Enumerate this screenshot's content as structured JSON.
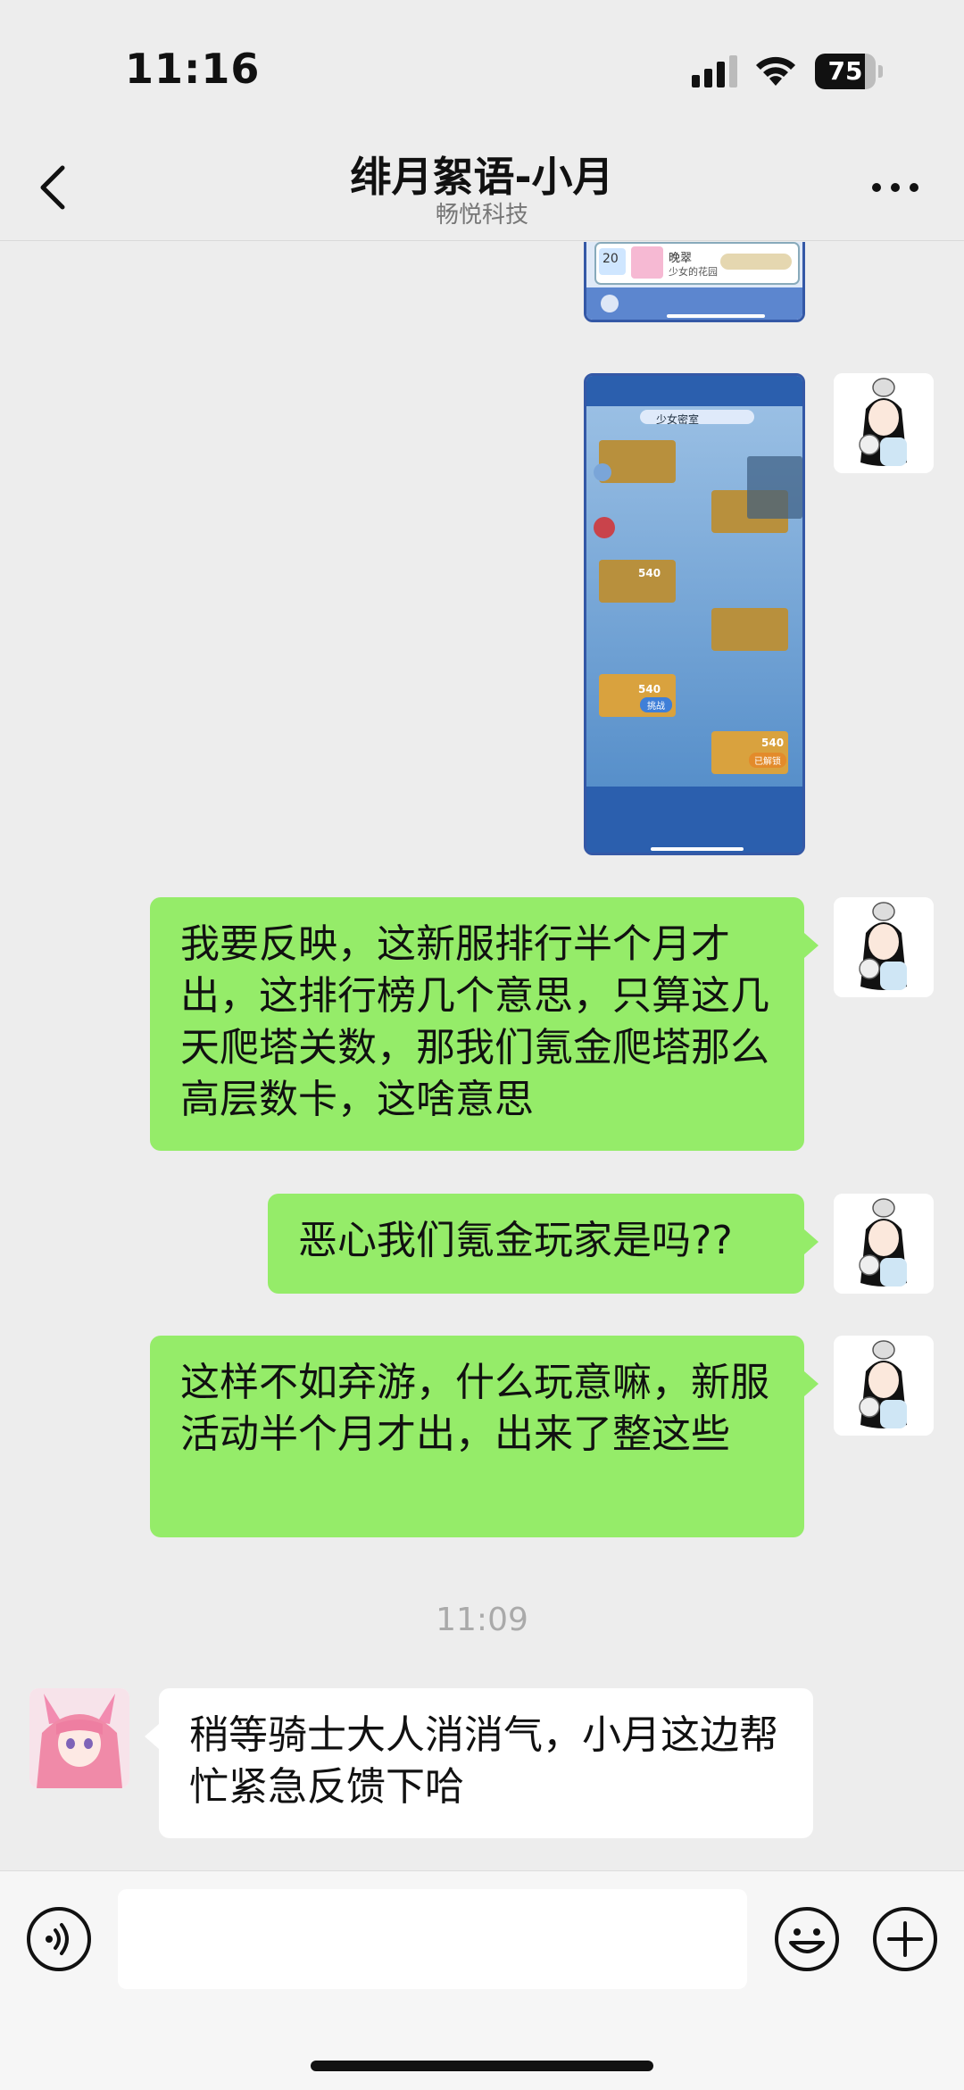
{
  "status_bar": {
    "time": "11:16",
    "battery": "75"
  },
  "header": {
    "title": "绯月絮语-小月",
    "subtitle": "畅悦科技"
  },
  "messages": [
    {
      "from": "me",
      "type": "image",
      "description_icon": "game-screenshot-partial"
    },
    {
      "from": "me",
      "type": "image",
      "image_title": "少女密室",
      "icon": "game-screenshot"
    },
    {
      "from": "me",
      "type": "text",
      "text": "我要反映，这新服排行半个月才出，这排行榜几个意思，只算这几天爬塔关数，那我们氪金爬塔那么高层数卡，这啥意思"
    },
    {
      "from": "me",
      "type": "text",
      "text": "恶心我们氪金玩家是吗??"
    },
    {
      "from": "me",
      "type": "text",
      "text": "这样不如弃游，什么玩意嘛，新服活动半个月才出，出来了整这些"
    },
    {
      "from": "other",
      "type": "text",
      "text": "稍等骑士大人消消气，小月这边帮忙紧急反馈下哈"
    }
  ],
  "timestamp": "11:09",
  "game_labels": {
    "challenge": "挑战",
    "unlocked": "已解锁",
    "score_a": "540",
    "score_b": "540",
    "score_c": "540",
    "level": "20",
    "name1": "晚翠",
    "name2": "少女的花园"
  },
  "input": {
    "placeholder": "",
    "value": ""
  },
  "colors": {
    "me_bubble": "#95ec69",
    "other_bubble": "#ffffff",
    "background": "#ededed"
  }
}
